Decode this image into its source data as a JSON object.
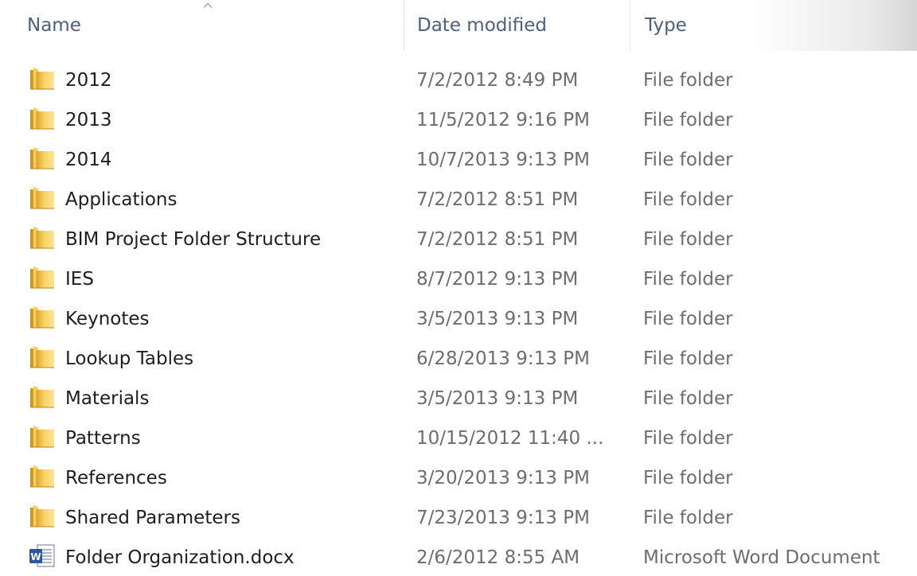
{
  "columns": {
    "name": "Name",
    "date": "Date modified",
    "type": "Type"
  },
  "rows": [
    {
      "name": "2012",
      "date": "7/2/2012 8:49 PM",
      "type": "File folder",
      "icon": "folder-icon"
    },
    {
      "name": "2013",
      "date": "11/5/2012 9:16 PM",
      "type": "File folder",
      "icon": "folder-icon"
    },
    {
      "name": "2014",
      "date": "10/7/2013 9:13 PM",
      "type": "File folder",
      "icon": "folder-icon"
    },
    {
      "name": "Applications",
      "date": "7/2/2012 8:51 PM",
      "type": "File folder",
      "icon": "folder-icon"
    },
    {
      "name": "BIM Project Folder Structure",
      "date": "7/2/2012 8:51 PM",
      "type": "File folder",
      "icon": "folder-icon"
    },
    {
      "name": "IES",
      "date": "8/7/2012 9:13 PM",
      "type": "File folder",
      "icon": "folder-icon"
    },
    {
      "name": "Keynotes",
      "date": "3/5/2013 9:13 PM",
      "type": "File folder",
      "icon": "folder-icon"
    },
    {
      "name": "Lookup Tables",
      "date": "6/28/2013 9:13 PM",
      "type": "File folder",
      "icon": "folder-icon"
    },
    {
      "name": "Materials",
      "date": "3/5/2013 9:13 PM",
      "type": "File folder",
      "icon": "folder-icon"
    },
    {
      "name": "Patterns",
      "date": "10/15/2012 11:40 ...",
      "type": "File folder",
      "icon": "folder-icon"
    },
    {
      "name": "References",
      "date": "3/20/2013 9:13 PM",
      "type": "File folder",
      "icon": "folder-icon"
    },
    {
      "name": "Shared Parameters",
      "date": "7/23/2013 9:13 PM",
      "type": "File folder",
      "icon": "folder-icon"
    },
    {
      "name": "Folder Organization.docx",
      "date": "2/6/2012 8:55 AM",
      "type": "Microsoft Word Document",
      "icon": "word-document-icon"
    }
  ],
  "colors": {
    "header_text": "#4c607a",
    "name_text": "#1e1e1e",
    "detail_text": "#6d6d6d",
    "folder_yellow": "#f2c94c",
    "word_blue": "#2b579a"
  }
}
